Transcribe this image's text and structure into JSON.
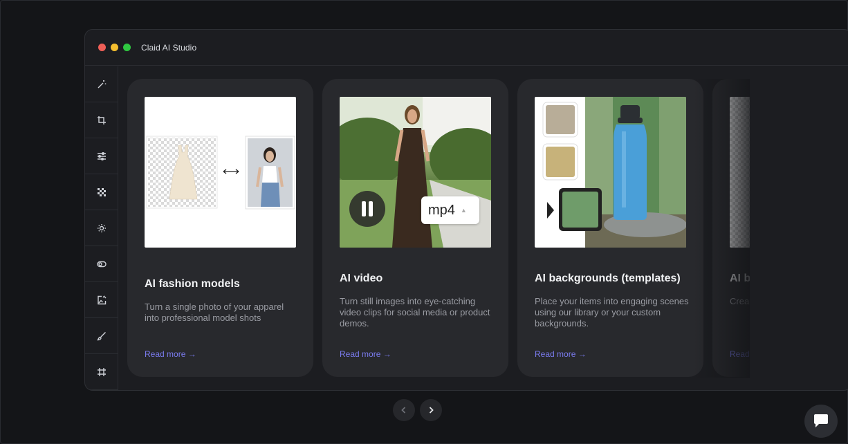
{
  "window": {
    "title": "Claid AI Studio"
  },
  "sidebar": {
    "tools": [
      {
        "icon": "magic-wand-icon"
      },
      {
        "icon": "crop-icon"
      },
      {
        "icon": "sliders-icon"
      },
      {
        "icon": "checkerboard-icon"
      },
      {
        "icon": "sun-icon"
      },
      {
        "icon": "toggle-icon"
      },
      {
        "icon": "image-edit-icon"
      },
      {
        "icon": "brush-icon"
      },
      {
        "icon": "frame-icon"
      }
    ]
  },
  "cards": [
    {
      "title": "AI fashion models",
      "description": "Turn a single photo of your apparel into professional model shots",
      "link": "Read more →"
    },
    {
      "title": "AI video",
      "description": "Turn still images into eye-catching video clips for social media or product demos.",
      "link": "Read more →",
      "format_label": "mp4"
    },
    {
      "title": "AI backgrounds (templates)",
      "description": "Place your items into engaging scenes using our library or your custom backgrounds.",
      "link": "Read more →"
    },
    {
      "title": "AI b",
      "description": "Crea phot desc",
      "link": "Read"
    }
  ],
  "colors": {
    "accent": "#7b7cf0",
    "card_bg": "#28292d",
    "page_bg": "#141518"
  }
}
